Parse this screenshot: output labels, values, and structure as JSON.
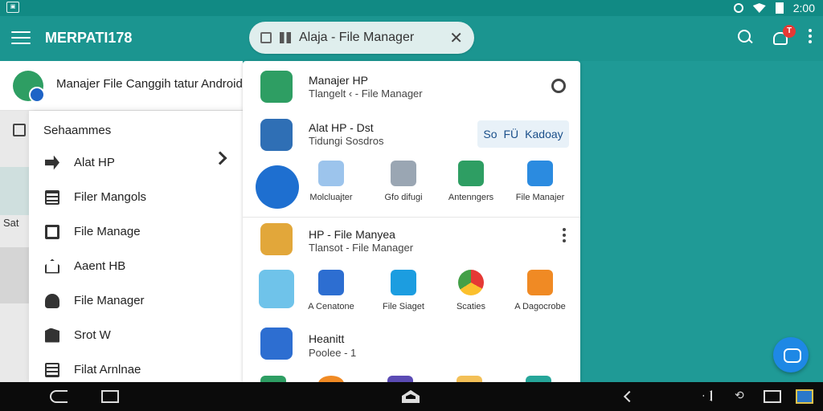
{
  "status_bar": {
    "left_icon": "screenshot-icon",
    "time": "2:00"
  },
  "app_bar": {
    "title": "MERPATI178",
    "tab_label": "Alaja - File Manager",
    "close_glyph": "✕",
    "notification_badge": "T"
  },
  "back_panel": {
    "title": "Manajer File Canggih tatur Android",
    "strip_text": "Sat"
  },
  "drawer": {
    "title": "Sehaammes",
    "items": [
      {
        "label": "Alat HP",
        "icon": "arrow-icon"
      },
      {
        "label": "Filer Mangols",
        "icon": "list-icon"
      },
      {
        "label": "File Manage",
        "icon": "document-icon"
      },
      {
        "label": "Aaent HB",
        "icon": "home-icon"
      },
      {
        "label": "File Manager",
        "icon": "cloud-icon"
      },
      {
        "label": "Srot W",
        "icon": "flag-icon"
      },
      {
        "label": "Filat Arnlnae",
        "icon": "archive-icon"
      }
    ]
  },
  "card": {
    "sections": [
      {
        "title": "Manajer HP",
        "subtitle": "Tlangelt ‹ - File Manager"
      },
      {
        "title": "Alat HP - Dst",
        "subtitle": "Tidungi Sosdros"
      },
      {
        "title": "HP - File Manyea",
        "subtitle": "Tlansot - File Manager"
      },
      {
        "title": "Heanitt",
        "subtitle": "Poolee - 1"
      }
    ],
    "share_button": {
      "prefix": "So",
      "mid": "FÜ",
      "label": "Kadoay"
    },
    "tiles_row1": [
      "Molcluajter",
      "Gfo difugi",
      "Antenngers",
      "File Manajer"
    ],
    "tiles_row2": [
      "A Cenatone",
      "File Siaget",
      "Scaties",
      "A Dagocrobe"
    ]
  },
  "colors": {
    "accent": "#1b9590",
    "fab": "#1e88e5",
    "badge": "#e53935"
  }
}
